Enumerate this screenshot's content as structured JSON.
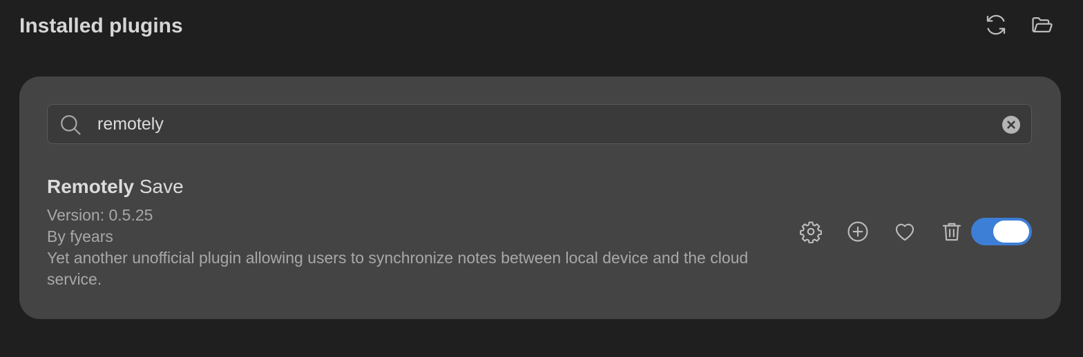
{
  "header": {
    "title": "Installed plugins",
    "reload_icon": "reload-icon",
    "folder_icon": "folder-open-icon"
  },
  "search": {
    "value": "remotely",
    "icon": "search-icon",
    "clear_icon": "clear-icon"
  },
  "plugin": {
    "name_highlight": "Remotely",
    "name_rest": " Save",
    "version": "Version: 0.5.25",
    "author": "By fyears",
    "description": "Yet another unofficial plugin allowing users to synchronize notes between local device and the cloud service.",
    "actions": [
      "gear-icon",
      "add-circle-icon",
      "heart-icon",
      "trash-icon"
    ],
    "enabled": true
  },
  "colors": {
    "background": "#1f1f1f",
    "card": "#444444",
    "accent": "#3d7ed6"
  }
}
